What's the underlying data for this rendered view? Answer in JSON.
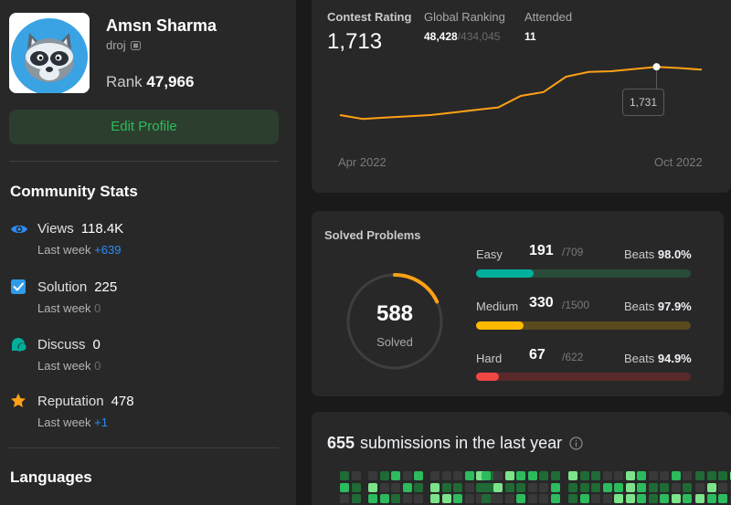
{
  "profile": {
    "name": "Amsn Sharma",
    "username": "droj",
    "rank_label": "Rank",
    "rank_value": "47,966",
    "edit_button": "Edit Profile"
  },
  "community": {
    "title": "Community Stats",
    "stats": [
      {
        "icon": "eye-icon",
        "label": "Views",
        "value": "118.4K",
        "sub_label": "Last week",
        "delta": "+639"
      },
      {
        "icon": "checkbox-icon",
        "label": "Solution",
        "value": "225",
        "sub_label": "Last week",
        "delta": "0"
      },
      {
        "icon": "discuss-icon",
        "label": "Discuss",
        "value": "0",
        "sub_label": "Last week",
        "delta": "0"
      },
      {
        "icon": "star-icon",
        "label": "Reputation",
        "value": "478",
        "sub_label": "Last week",
        "delta": "+1"
      }
    ]
  },
  "languages": {
    "title": "Languages"
  },
  "contest": {
    "rating_label": "Contest Rating",
    "rating_value": "1,713",
    "global_label": "Global Ranking",
    "global_value": "48,428",
    "global_total": "/434,045",
    "attended_label": "Attended",
    "attended_value": "11",
    "axis_start": "Apr 2022",
    "axis_end": "Oct 2022",
    "tooltip": "1,731"
  },
  "chart_data": {
    "type": "line",
    "x_labels": [
      "Apr 2022",
      "Oct 2022"
    ],
    "series": [
      {
        "values": [
          1580,
          1568,
          1572,
          1576,
          1580,
          1588,
          1596,
          1604,
          1640,
          1652,
          1700,
          1715,
          1717,
          1724,
          1731,
          1727,
          1722
        ]
      }
    ],
    "highlight": {
      "value": 1731
    },
    "color": "#ffa116"
  },
  "solved": {
    "title": "Solved Problems",
    "total": "588",
    "total_label": "Solved",
    "progress": 0.18,
    "levels": [
      {
        "name": "Easy",
        "count": "191",
        "total": "/709",
        "beats_label": "Beats",
        "beats": "98.0%",
        "fill": 0.27,
        "color": "#00af9b",
        "track": "#2a4a3a"
      },
      {
        "name": "Medium",
        "count": "330",
        "total": "/1500",
        "beats_label": "Beats",
        "beats": "97.9%",
        "fill": 0.22,
        "color": "#ffb800",
        "track": "#5a4a1e"
      },
      {
        "name": "Hard",
        "count": "67",
        "total": "/622",
        "beats_label": "Beats",
        "beats": "94.9%",
        "fill": 0.108,
        "color": "#ef4743",
        "track": "#5a2a2a"
      }
    ]
  },
  "submissions": {
    "count": "655",
    "text": "submissions in the last year"
  },
  "colors": {
    "accent": "#ffa116",
    "green": "#2cbb5d",
    "blue": "#2f8cf5"
  }
}
